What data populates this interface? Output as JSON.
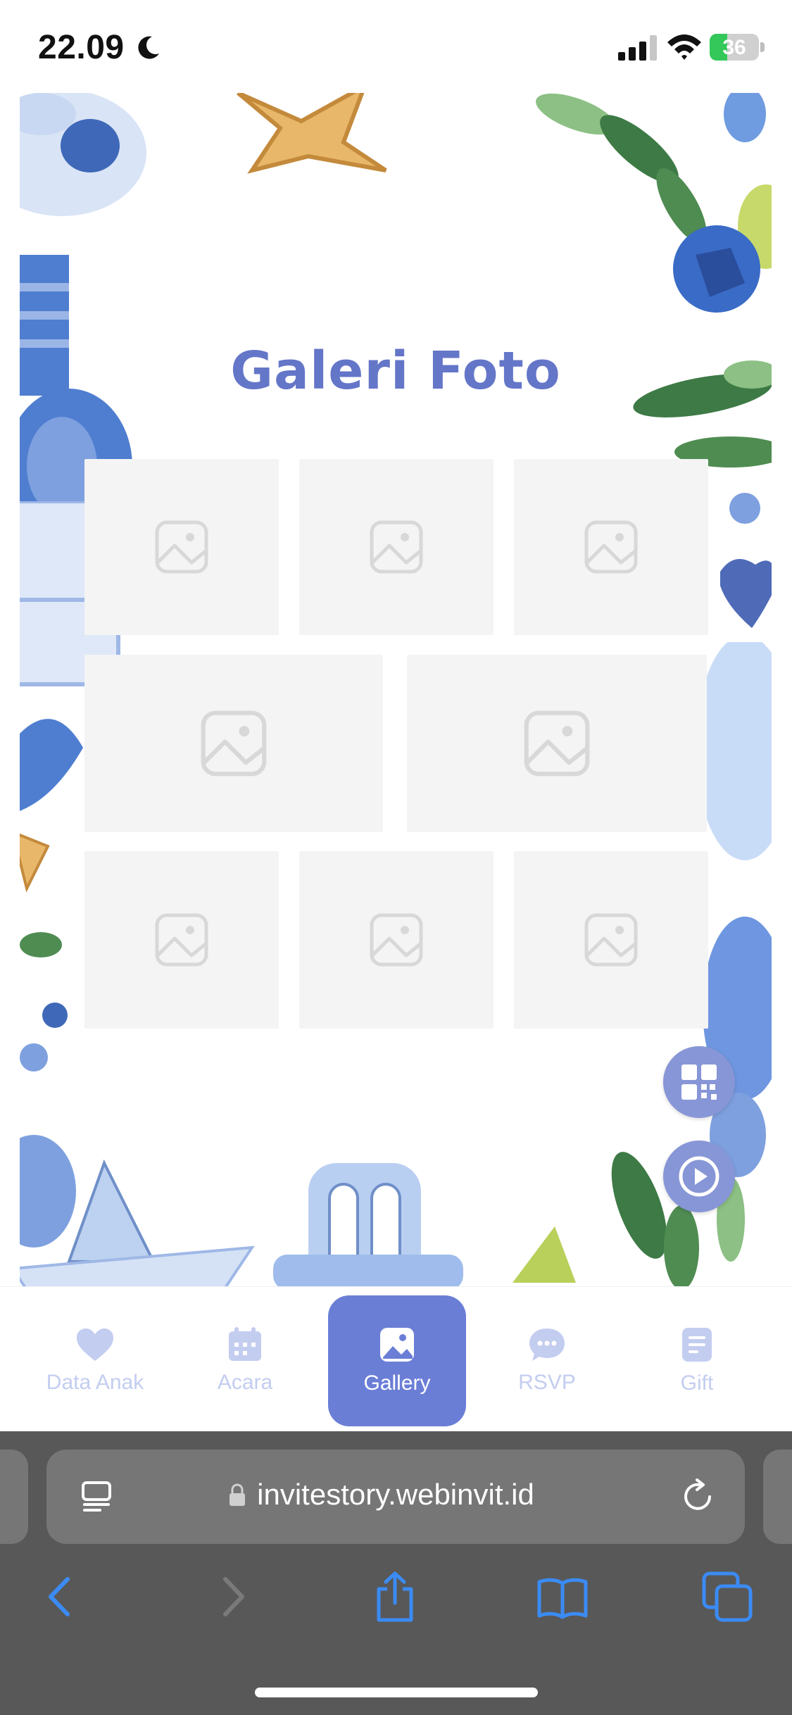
{
  "status_bar": {
    "time": "22.09",
    "battery_percent": "36",
    "battery_level": 0.36,
    "battery_color": "#34c759"
  },
  "page": {
    "title": "Galeri Foto",
    "title_color": "#6476c8",
    "photo_placeholders": 8,
    "fab_color": "#8796d6",
    "fabs": [
      {
        "icon": "qr-code-icon"
      },
      {
        "icon": "play-icon"
      }
    ]
  },
  "tabs": [
    {
      "label": "Data Anak",
      "icon": "heart-icon",
      "active": false
    },
    {
      "label": "Acara",
      "icon": "calendar-icon",
      "active": false
    },
    {
      "label": "Gallery",
      "icon": "image-icon",
      "active": true
    },
    {
      "label": "RSVP",
      "icon": "chat-bubble-icon",
      "active": false
    },
    {
      "label": "Gift",
      "icon": "document-icon",
      "active": false
    }
  ],
  "tab_colors": {
    "accent": "#6b7ed6",
    "inactive": "#c3cdf0"
  },
  "browser": {
    "url": "invitestory.webinvit.id",
    "toolbar": [
      {
        "icon": "back-icon"
      },
      {
        "icon": "forward-icon"
      },
      {
        "icon": "share-icon"
      },
      {
        "icon": "bookmarks-icon"
      },
      {
        "icon": "tabs-icon"
      }
    ]
  }
}
